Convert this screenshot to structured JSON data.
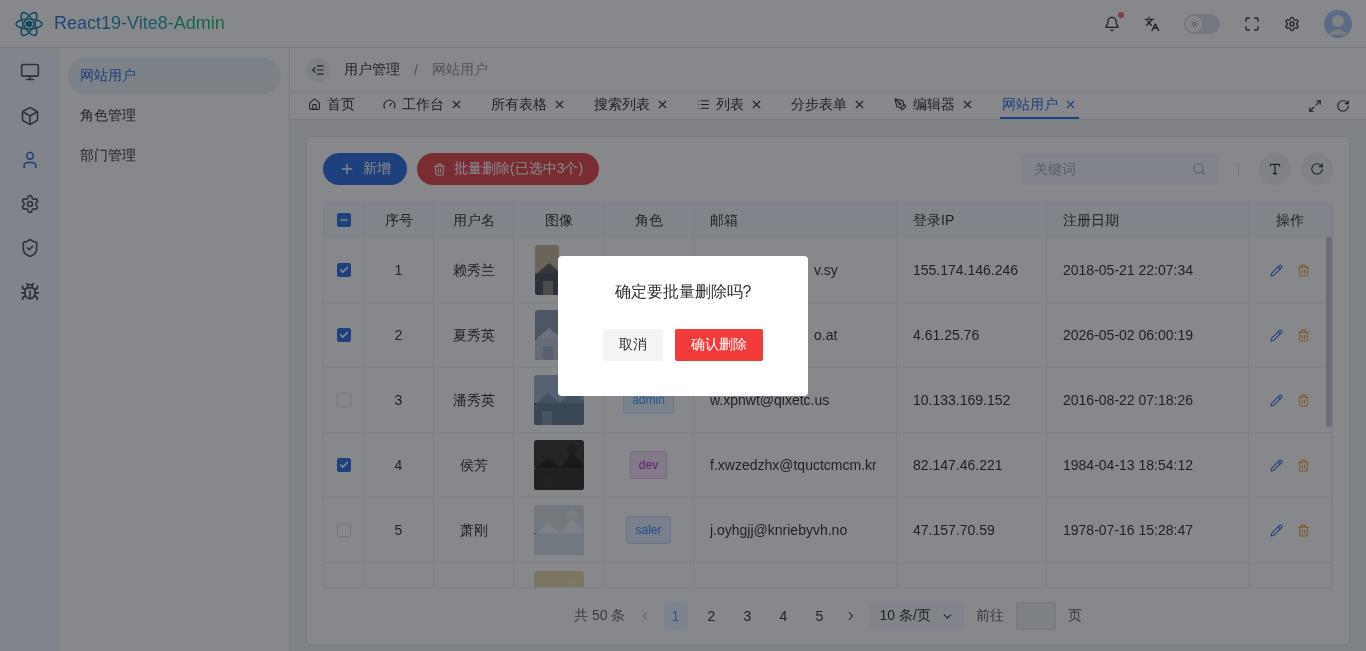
{
  "app": {
    "title": "React19-Vite8-Admin"
  },
  "header": {
    "notification_dot": true,
    "theme_switch": {
      "on": false
    }
  },
  "rail": [
    {
      "kind": "monitor",
      "selected": false
    },
    {
      "kind": "box",
      "selected": false
    },
    {
      "kind": "user",
      "selected": true
    },
    {
      "kind": "gear",
      "selected": false
    },
    {
      "kind": "shield",
      "selected": false
    },
    {
      "kind": "bug",
      "selected": false
    }
  ],
  "submenu": [
    {
      "label": "网站用户",
      "selected": true
    },
    {
      "label": "角色管理",
      "selected": false
    },
    {
      "label": "部门管理",
      "selected": false
    }
  ],
  "breadcrumb": {
    "items": [
      "用户管理",
      "网站用户"
    ],
    "separator": "/"
  },
  "tabs": [
    {
      "label": "首页",
      "closable": false,
      "selected": false
    },
    {
      "label": "工作台",
      "closable": true,
      "selected": false
    },
    {
      "label": "所有表格",
      "closable": true,
      "selected": false
    },
    {
      "label": "搜索列表",
      "closable": true,
      "selected": false
    },
    {
      "label": "列表",
      "closable": true,
      "selected": false
    },
    {
      "label": "分步表单",
      "closable": true,
      "selected": false
    },
    {
      "label": "编辑器",
      "closable": true,
      "selected": false
    },
    {
      "label": "网站用户",
      "closable": true,
      "selected": true
    }
  ],
  "toolbar": {
    "add_button": "新增",
    "batch_delete_button": "批量删除(已选中3个)",
    "search": {
      "placeholder": "关键词"
    }
  },
  "table": {
    "select_all": {
      "indeterminate": true
    },
    "columns": [
      "序号",
      "用户名",
      "图像",
      "角色",
      "邮箱",
      "登录IP",
      "注册日期",
      "操作"
    ],
    "rows": [
      {
        "kind": "full",
        "checked": true,
        "index": "1",
        "name": "赖秀兰",
        "email": "v.sy",
        "covered": true,
        "ip": "155.174.146.246",
        "date": "2018-05-21 22:07:34"
      },
      {
        "kind": "full",
        "checked": true,
        "index": "2",
        "name": "夏秀英",
        "email": "o.at",
        "covered": true,
        "ip": "4.61.25.76",
        "date": "2026-05-02 06:00:19"
      },
      {
        "kind": "full",
        "checked": false,
        "index": "3",
        "name": "潘秀英",
        "role": {
          "label": "admin",
          "kind": "primary"
        },
        "email": "w.xpnwt@qixetc.us",
        "covered": false,
        "ip": "10.133.169.152",
        "date": "2016-08-22 07:18:26"
      },
      {
        "kind": "full",
        "checked": true,
        "index": "4",
        "name": "侯芳",
        "role": {
          "label": "dev",
          "kind": "purple"
        },
        "email": "f.xwzedzhx@tquctcmcm.kr",
        "covered": false,
        "ip": "82.147.46.221",
        "date": "1984-04-13 18:54:12"
      },
      {
        "kind": "full",
        "checked": false,
        "index": "5",
        "name": "萧刚",
        "role": {
          "label": "saler",
          "kind": "info"
        },
        "email": "j.oyhgjj@knriebyvh.no",
        "covered": false,
        "ip": "47.157.70.59",
        "date": "1978-07-16 15:28:47"
      },
      {
        "kind": "partial"
      }
    ]
  },
  "pagination": {
    "total": "共 50 条",
    "pages": [
      {
        "label": "1",
        "selected": true
      },
      {
        "label": "2",
        "selected": false
      },
      {
        "label": "3",
        "selected": false
      },
      {
        "label": "4",
        "selected": false
      },
      {
        "label": "5",
        "selected": false
      }
    ],
    "page_size": "10 条/页",
    "goto_label": "前往",
    "page_suffix": "页"
  },
  "dialog": {
    "message": "确定要批量删除吗?",
    "cancel": "取消",
    "confirm": "确认删除"
  }
}
